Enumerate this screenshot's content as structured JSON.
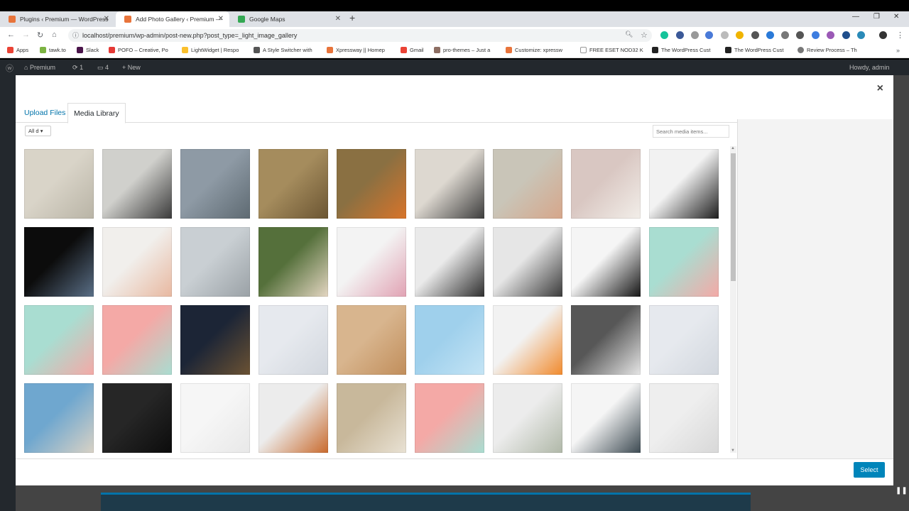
{
  "browser": {
    "tabs": [
      {
        "title": "Plugins ‹ Premium — WordPress",
        "active": false,
        "color": "#e8743b"
      },
      {
        "title": "Add Photo Gallery ‹ Premium —",
        "active": true,
        "color": "#e8743b"
      },
      {
        "title": "Google Maps",
        "active": false,
        "color": "#34a853"
      }
    ],
    "new_tab": "+",
    "url": "localhost/premium/wp-admin/post-new.php?post_type=_light_image_gallery",
    "bookmarks": [
      "Apps",
      "tawk.to",
      "Slack",
      "POFO – Creative, Po",
      "LightWidget | Respo",
      "A Style Switcher with",
      "Xpressway || Homep",
      "Gmail",
      "pro-themes – Just a",
      "Customize: xpressw",
      "FREE ESET NOD32 K",
      "The WordPress Cust",
      "The WordPress Cust",
      "Review Process – Th"
    ]
  },
  "adminbar": {
    "site": "Premium",
    "updates": "1",
    "comments": "4",
    "new": "New",
    "howdy": "Howdy, admin"
  },
  "modal": {
    "close": "×",
    "tabs": {
      "upload": "Upload Files",
      "library": "Media Library"
    },
    "filter": "All d",
    "search_placeholder": "Search media items...",
    "select_label": "Select"
  },
  "media_items": [
    {
      "name": "map-hands",
      "colors": [
        "#d9d4c8",
        "#b9b4a6"
      ]
    },
    {
      "name": "compass-camera",
      "colors": [
        "#d0d0cc",
        "#3a3a3a"
      ]
    },
    {
      "name": "map-sunglasses",
      "colors": [
        "#8e9aa5",
        "#5e6a72"
      ]
    },
    {
      "name": "eiffel-map",
      "colors": [
        "#a58c5d",
        "#6b5532"
      ]
    },
    {
      "name": "pins-map",
      "colors": [
        "#8a7042",
        "#d8742a"
      ]
    },
    {
      "name": "crumpled-map",
      "colors": [
        "#ddd8d0",
        "#3c3c3c"
      ]
    },
    {
      "name": "map-finger",
      "colors": [
        "#c9c5b8",
        "#d6a68a"
      ]
    },
    {
      "name": "white-heels",
      "colors": [
        "#d9c7c2",
        "#f2eee9"
      ]
    },
    {
      "name": "cameras",
      "colors": [
        "#f2f2f2",
        "#1c1c1c"
      ]
    },
    {
      "name": "joker-poster",
      "colors": [
        "#0c0c0c",
        "#5a6f87"
      ]
    },
    {
      "name": "sunglasses",
      "colors": [
        "#f1efec",
        "#e8b8a0"
      ]
    },
    {
      "name": "laptop",
      "colors": [
        "#c9cfd3",
        "#9aa1a6"
      ]
    },
    {
      "name": "man-tablet",
      "colors": [
        "#55703b",
        "#e4d6c2"
      ]
    },
    {
      "name": "desk-phone",
      "colors": [
        "#f3f3f3",
        "#e1a2b3"
      ]
    },
    {
      "name": "watch-1",
      "colors": [
        "#eaeaea",
        "#2e2e2e"
      ]
    },
    {
      "name": "watch-2",
      "colors": [
        "#e6e6e6",
        "#3a3a3a"
      ]
    },
    {
      "name": "camera-black",
      "colors": [
        "#f5f5f5",
        "#151515"
      ]
    },
    {
      "name": "headphones-mint-pink",
      "colors": [
        "#a9ddd1",
        "#f4a9a6"
      ]
    },
    {
      "name": "headphones-pink",
      "colors": [
        "#a9ddd1",
        "#f4a9a6"
      ]
    },
    {
      "name": "headphones-mint",
      "colors": [
        "#f4a9a6",
        "#a9ddd1"
      ]
    },
    {
      "name": "dark-object",
      "colors": [
        "#1c2536",
        "#6b5233"
      ]
    },
    {
      "name": "dart-1",
      "colors": [
        "#e6e9ee",
        "#d2d7de"
      ]
    },
    {
      "name": "bulb",
      "colors": [
        "#d8b58e",
        "#c18e5b"
      ]
    },
    {
      "name": "rings",
      "colors": [
        "#9fd0ec",
        "#c4e4f5"
      ]
    },
    {
      "name": "orange-bottle",
      "colors": [
        "#f2f2f2",
        "#f18a2d"
      ]
    },
    {
      "name": "grey-jars",
      "colors": [
        "#575757",
        "#e6e6e6"
      ]
    },
    {
      "name": "dart-2",
      "colors": [
        "#e6e9ee",
        "#d2d7de"
      ]
    },
    {
      "name": "stool",
      "colors": [
        "#6fa7cf",
        "#d9d2c5"
      ]
    },
    {
      "name": "bicycle",
      "colors": [
        "#262626",
        "#0c0c0c"
      ]
    },
    {
      "name": "airpods",
      "colors": [
        "#f6f6f6",
        "#e8e8e8"
      ]
    },
    {
      "name": "hammer",
      "colors": [
        "#ececec",
        "#c96a2d"
      ]
    },
    {
      "name": "cosmetics",
      "colors": [
        "#c8b89b",
        "#e9e2d4"
      ]
    },
    {
      "name": "clock",
      "colors": [
        "#f4a9a6",
        "#a9ddd1"
      ]
    },
    {
      "name": "coconut-bottle",
      "colors": [
        "#ececec",
        "#b0b8a8"
      ]
    },
    {
      "name": "echo-dot",
      "colors": [
        "#f5f5f5",
        "#3d4a52"
      ]
    },
    {
      "name": "mug",
      "colors": [
        "#eeeeee",
        "#d8d8d8"
      ]
    }
  ]
}
